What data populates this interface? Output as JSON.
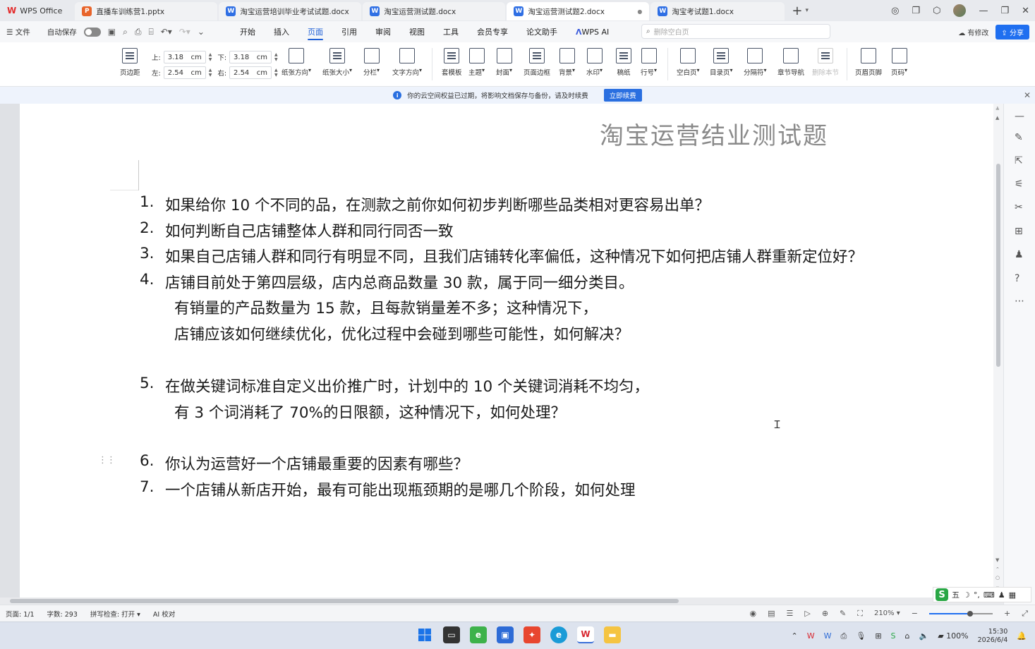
{
  "tabs": {
    "app": "WPS Office",
    "items": [
      {
        "label": "直播车训练营1.pptx",
        "type": "P",
        "kind": "ppt"
      },
      {
        "label": "淘宝运营培训毕业考试试题.docx",
        "type": "W",
        "kind": "doc"
      },
      {
        "label": "淘宝运营测试题.docx",
        "type": "W",
        "kind": "doc"
      },
      {
        "label": "淘宝运营测试题2.docx",
        "type": "W",
        "kind": "doc",
        "active": true
      },
      {
        "label": "淘宝考试题1.docx",
        "type": "W",
        "kind": "doc"
      }
    ]
  },
  "menubar": {
    "file": "文件",
    "autosave": "自动保存",
    "menus": [
      "开始",
      "插入",
      "页面",
      "引用",
      "审阅",
      "视图",
      "工具",
      "会员专享",
      "论文助手"
    ],
    "active_menu": "页面",
    "wps_ai": "WPS AI",
    "search_placeholder": "删除空白页",
    "modified": "有修改",
    "share": "分享"
  },
  "ribbon": {
    "margins_label": "页边距",
    "top_label": "上:",
    "top_value": "3.18",
    "bottom_label": "下:",
    "bottom_value": "3.18",
    "left_label": "左:",
    "left_value": "2.54",
    "right_label": "右:",
    "right_value": "2.54",
    "unit": "cm",
    "buttons": [
      "纸张方向",
      "纸张大小",
      "分栏",
      "文字方向",
      "套模板",
      "主题",
      "封面",
      "页面边框",
      "背景",
      "水印",
      "稿纸",
      "行号",
      "空白页",
      "目录页",
      "分隔符",
      "章节导航",
      "删除本节",
      "页眉页脚",
      "页码"
    ]
  },
  "notice": {
    "text": "你的云空间权益已过期，将影响文档保存与备份，请及时续费",
    "button": "立即续费"
  },
  "document": {
    "title": "淘宝运营结业测试题",
    "lines": [
      {
        "num": "1.",
        "text": "如果给你 10 个不同的品，在测款之前你如何初步判断哪些品类相对更容易出单？"
      },
      {
        "num": "2.",
        "text": "如何判断自己店铺整体人群和同行同否一致"
      },
      {
        "num": "3.",
        "text": "如果自己店铺人群和同行有明显不同，且我们店铺转化率偏低，这种情况下如何把店铺人群重新定位好？"
      },
      {
        "num": "4.",
        "text": "店铺目前处于第四层级，店内总商品数量 30 款，属于同一细分类目。"
      },
      {
        "num": "",
        "text": "有销量的产品数量为 15 款，且每款销量差不多；这种情况下，"
      },
      {
        "num": "",
        "text": "店铺应该如何继续优化，优化过程中会碰到哪些可能性，如何解决？"
      },
      {
        "num": "5.",
        "text": "在做关键词标准自定义出价推广时，计划中的 10 个关键词消耗不均匀，"
      },
      {
        "num": "",
        "text": "有 3 个词消耗了 70%的日限额，这种情况下，如何处理？"
      },
      {
        "num": "6.",
        "text": "你认为运营好一个店铺最重要的因素有哪些？"
      },
      {
        "num": "7.",
        "text": "一个店铺从新店开始，最有可能出现瓶颈期的是哪几个阶段，如何处理"
      }
    ]
  },
  "ime": {
    "label": "五"
  },
  "statusbar": {
    "page": "页面: 1/1",
    "words": "字数: 293",
    "spell": "拼写检查: 打开",
    "ai": "AI 校对",
    "zoom": "210%",
    "zoom_fraction": 0.6
  },
  "taskbar": {
    "battery": "100%",
    "time": "15:30",
    "date": "2026/6/4"
  }
}
